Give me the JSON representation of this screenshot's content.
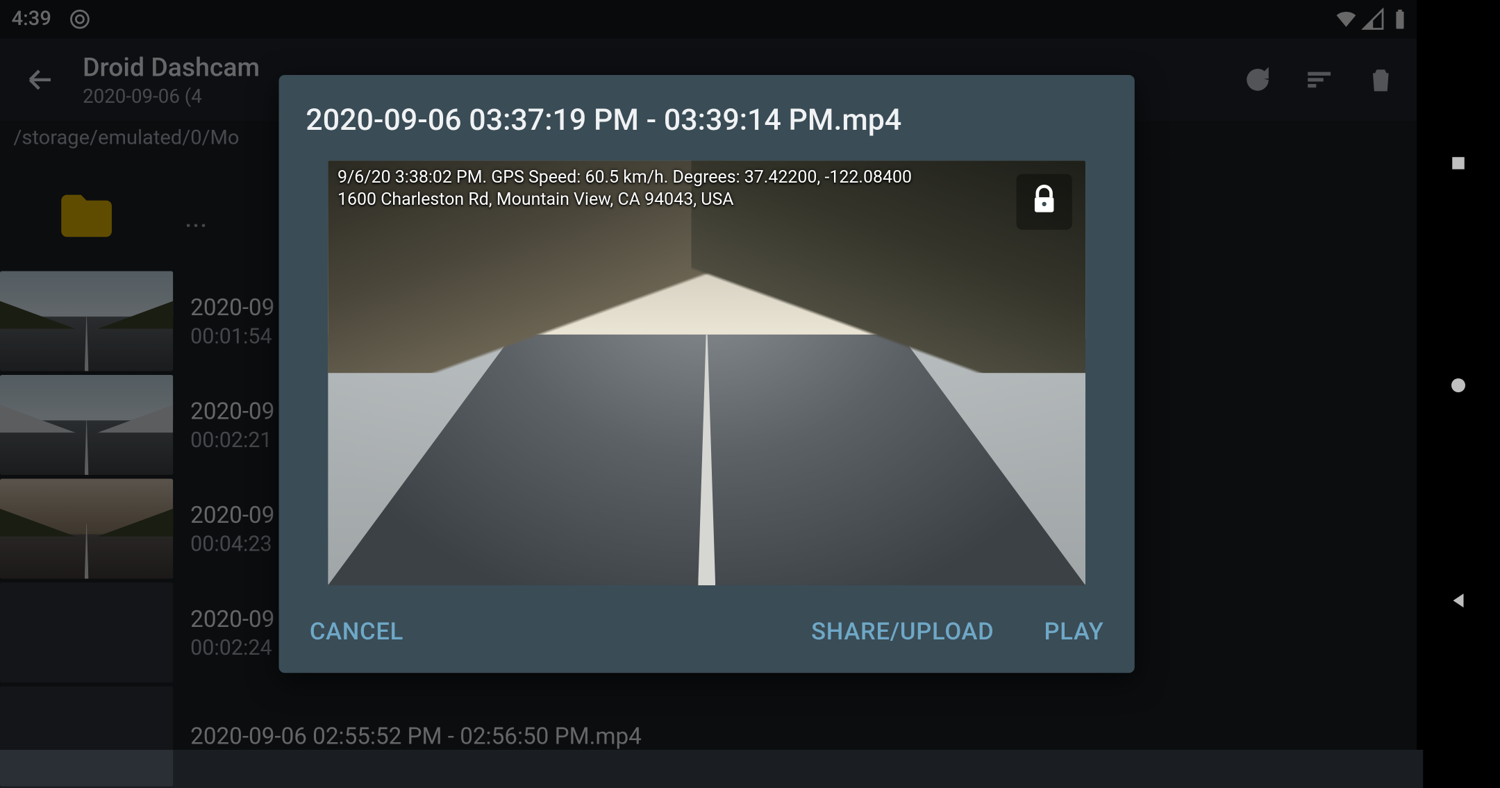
{
  "status": {
    "time": "4:39"
  },
  "actionbar": {
    "title": "Droid Dashcam",
    "subtitle": "2020-09-06 (4"
  },
  "breadcrumb": "/storage/emulated/0/Mo",
  "rows": [
    {
      "type": "folder",
      "dots": "..."
    },
    {
      "title": "2020-09",
      "duration": "00:01:54"
    },
    {
      "title": "2020-09",
      "duration": "00:02:21"
    },
    {
      "title": "2020-09",
      "duration": "00:04:23"
    },
    {
      "title": "2020-09",
      "duration": "00:02:24"
    },
    {
      "title": "2020-09-06 02:55:52 PM - 02:56:50 PM.mp4",
      "duration": ""
    }
  ],
  "dialog": {
    "title": "2020-09-06 03:37:19 PM - 03:39:14 PM.mp4",
    "overlay_line1": "9/6/20 3:38:02 PM. GPS Speed: 60.5 km/h. Degrees: 37.42200, -122.08400",
    "overlay_line2": "1600 Charleston Rd, Mountain View, CA 94043, USA",
    "cancel": "CANCEL",
    "share": "SHARE/UPLOAD",
    "play": "PLAY"
  }
}
